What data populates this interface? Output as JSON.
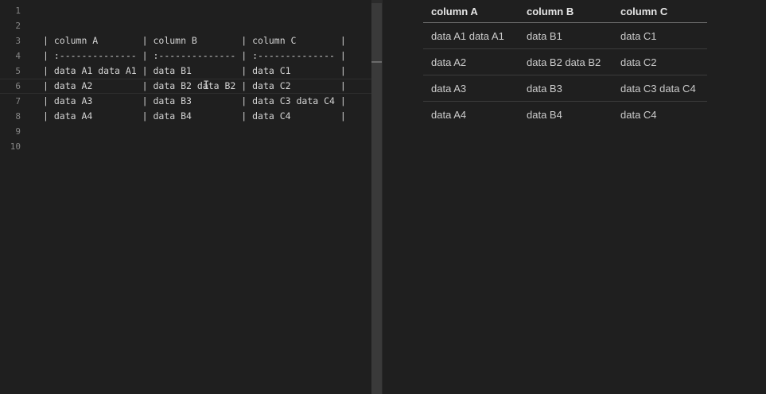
{
  "editor": {
    "lines": [
      {
        "num": "1",
        "text": ""
      },
      {
        "num": "2",
        "text": ""
      },
      {
        "num": "3",
        "text": "| column A        | column B        | column C        |"
      },
      {
        "num": "4",
        "text": "| :-------------- | :-------------- | :-------------- |"
      },
      {
        "num": "5",
        "text": "| data A1 data A1 | data B1         | data C1         |"
      },
      {
        "num": "6",
        "text": "| data A2         | data B2 data B2 | data C2         |"
      },
      {
        "num": "7",
        "text": "| data A3         | data B3         | data C3 data C4 |"
      },
      {
        "num": "8",
        "text": "| data A4         | data B4         | data C4         |"
      },
      {
        "num": "9",
        "text": ""
      },
      {
        "num": "10",
        "text": ""
      }
    ]
  },
  "preview": {
    "headers": [
      "column A",
      "column B",
      "column C"
    ],
    "rows": [
      [
        "data A1 data A1",
        "data B1",
        "data C1"
      ],
      [
        "data A2",
        "data B2 data B2",
        "data C2"
      ],
      [
        "data A3",
        "data B3",
        "data C3 data C4"
      ],
      [
        "data A4",
        "data B4",
        "data C4"
      ]
    ]
  }
}
